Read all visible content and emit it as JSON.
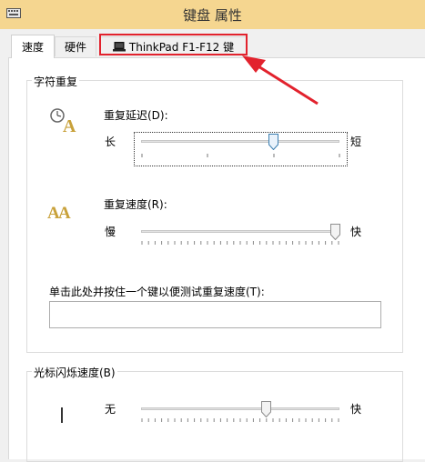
{
  "window": {
    "title": "键盘 属性"
  },
  "tabs": [
    {
      "label": "速度",
      "active": true
    },
    {
      "label": "硬件",
      "active": false
    },
    {
      "label": "ThinkPad F1-F12 键",
      "active": false
    }
  ],
  "annotation": {
    "highlight_color": "#e2222d"
  },
  "repeat_group": {
    "title": "字符重复",
    "delay": {
      "label": "重复延迟(D):",
      "min_label": "长",
      "max_label": "短",
      "value_fraction": 0.65
    },
    "rate": {
      "label": "重复速度(R):",
      "min_label": "慢",
      "max_label": "快",
      "value_fraction": 1.0
    },
    "test_label": "单击此处并按住一个键以便测试重复速度(T):",
    "test_value": ""
  },
  "cursor_group": {
    "title": "光标闪烁速度(B)",
    "blink": {
      "min_label": "无",
      "max_label": "快",
      "value_fraction": 0.62
    }
  },
  "colors": {
    "titlebar": "#f5d690",
    "window_bg": "#f0f0f0"
  }
}
